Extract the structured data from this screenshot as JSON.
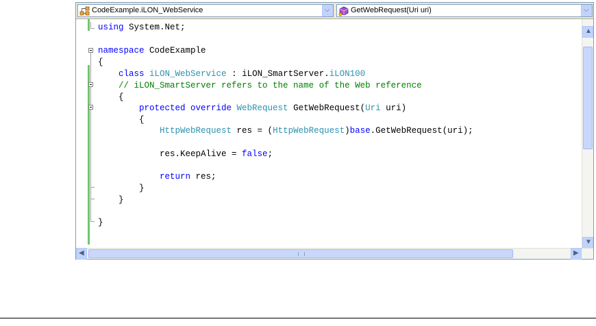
{
  "navbar": {
    "type_combo": {
      "label": "CodeExample.iLON_WebService",
      "icon": "class-icon"
    },
    "member_combo": {
      "label": "GetWebRequest(Uri uri)",
      "icon": "method-icon"
    }
  },
  "code": {
    "line1": {
      "kw": "using",
      "rest": " System.Net;"
    },
    "line3": {
      "kw": "namespace",
      "rest": " CodeExample"
    },
    "line4": {
      "text": "{"
    },
    "line5": {
      "indent": "    ",
      "kw": "class",
      "type": " iLON_WebService",
      "mid": " : iLON_SmartServer.",
      "type2": "iLON100"
    },
    "line6": {
      "indent": "    ",
      "comment": "// iLON_SmartServer refers to the name of the Web reference"
    },
    "line7": {
      "indent": "    ",
      "text": "{"
    },
    "line8": {
      "indent": "        ",
      "kw": "protected override",
      "type": " WebRequest",
      "mid": " GetWebRequest(",
      "type2": "Uri",
      "rest": " uri)"
    },
    "line9": {
      "indent": "        ",
      "text": "{"
    },
    "line10": {
      "indent": "            ",
      "type": "HttpWebRequest",
      "mid": " res = (",
      "type2": "HttpWebRequest",
      "mid2": ")",
      "kw": "base",
      "rest": ".GetWebRequest(uri);"
    },
    "line12": {
      "indent": "            ",
      "pre": "res.KeepAlive = ",
      "kw": "false",
      "rest": ";"
    },
    "line14": {
      "indent": "            ",
      "kw": "return",
      "rest": " res;"
    },
    "line15": {
      "indent": "        ",
      "text": "}"
    },
    "line16": {
      "indent": "    ",
      "text": "}"
    },
    "line18": {
      "text": "}"
    }
  },
  "colors": {
    "keyword": "#0000ff",
    "type": "#2b91af",
    "comment": "#008000",
    "change_bar": "#6cc76c"
  }
}
